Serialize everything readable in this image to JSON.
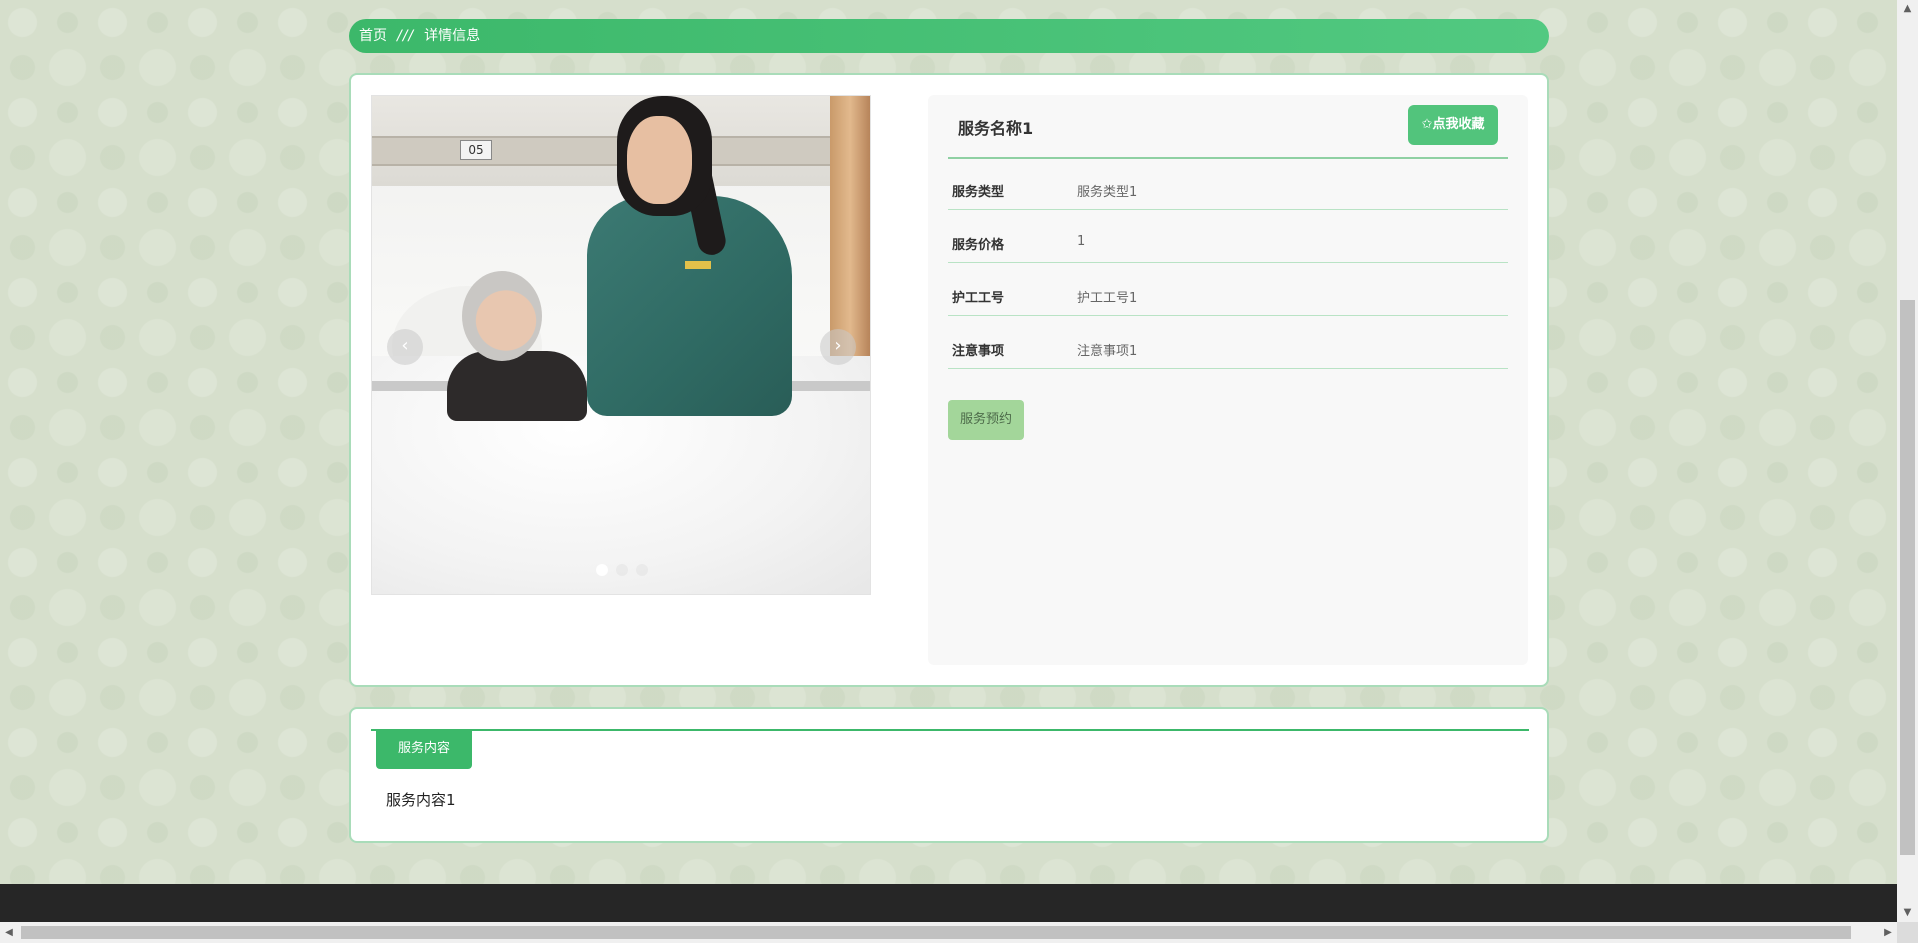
{
  "breadcrumb": {
    "home": "首页",
    "separator": "///",
    "current": "详情信息"
  },
  "carousel": {
    "prev_icon": "‹",
    "next_icon": "›",
    "room_tag": "05",
    "slide_count": 3,
    "active_slide": 1
  },
  "detail": {
    "service_name": "服务名称1",
    "favorite_label": "✩点我收藏",
    "fields": [
      {
        "label": "服务类型",
        "value": "服务类型1"
      },
      {
        "label": "服务价格",
        "value": "1"
      },
      {
        "label": "护工工号",
        "value": "护工工号1"
      },
      {
        "label": "注意事项",
        "value": "注意事项1"
      }
    ],
    "book_label": "服务预约"
  },
  "content": {
    "tab_label": "服务内容",
    "text": "服务内容1"
  },
  "colors": {
    "accent": "#3cb86a",
    "background": "#d6dfcc",
    "footer": "#262626"
  },
  "scrollbars": {
    "up_icon": "▲",
    "down_icon": "▼",
    "left_icon": "◀",
    "right_icon": "▶"
  }
}
